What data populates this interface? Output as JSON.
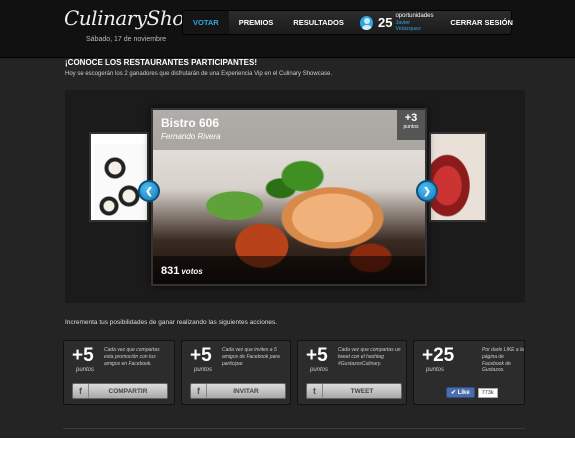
{
  "header": {
    "logo_text": "CulinaryShowcase",
    "date": "Sábado, 17 de noviembre",
    "nav": {
      "votar": "VOTAR",
      "premios": "PREMIOS",
      "resultados": "RESULTADOS",
      "count": "25",
      "count_label": "oportunidades",
      "user": "Javier Velázquez",
      "logout": "CERRAR SESIÓN"
    }
  },
  "intro": {
    "title": "¡CONOCE LOS RESTAURANTES PARTICIPANTES!",
    "text": "Hoy se escogerán los 2 ganadores que disfrutarán de una Experiencia Vip en el Culinary Showcase."
  },
  "carousel": {
    "restaurant": "Bistro 606",
    "chef": "Fernando Rivera",
    "points": "+3",
    "points_label": "puntos",
    "votes": "831",
    "votes_label": "votos"
  },
  "actions": {
    "intro": "Incrementa tus posibilidades de ganar realizando las siguientes acciones.",
    "panels": [
      {
        "points": "+5",
        "points_label": "puntos",
        "desc": "Cada vez que compartas esta promoción con tus amigos en Facebook.",
        "button": "COMPARTIR",
        "icon": "f"
      },
      {
        "points": "+5",
        "points_label": "puntos",
        "desc": "Cada vez que invites a 5 amigos de Facebook para participar.",
        "button": "INVITAR",
        "icon": "f"
      },
      {
        "points": "+5",
        "points_label": "puntos",
        "desc": "Cada vez que compartas un tweet con el hashtag #GustazosCulinary.",
        "button": "TWEET",
        "icon": "t"
      },
      {
        "points": "+25",
        "points_label": "puntos",
        "desc": "Por darle LIKE a la página de Facebook de Gustazos.",
        "like": "Like",
        "like_count": "773k"
      }
    ]
  }
}
